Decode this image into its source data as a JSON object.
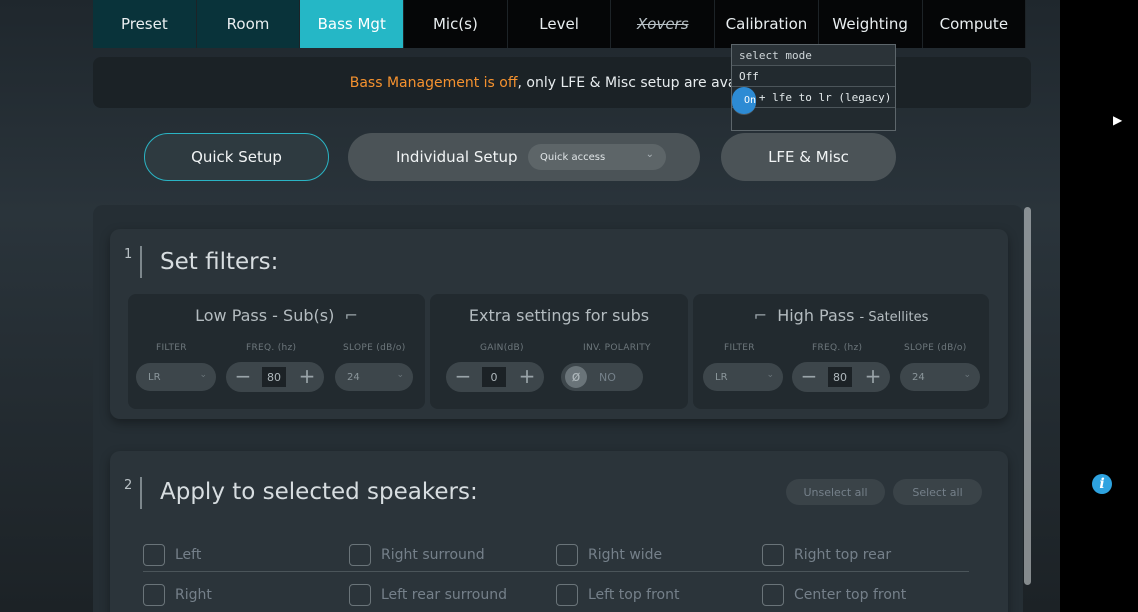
{
  "tabs": [
    "Preset",
    "Room",
    "Bass Mgt",
    "Mic(s)",
    "Level",
    "Xovers",
    "Calibration",
    "Weighting",
    "Compute"
  ],
  "notice": {
    "highlight": "Bass Management is off",
    "rest": ", only LFE & Misc setup are available"
  },
  "mode_buttons": {
    "quick": "Quick Setup",
    "individual": "Individual Setup",
    "quick_access": "Quick access",
    "lfe": "LFE & Misc"
  },
  "dropdown": {
    "header": "select mode",
    "options": [
      "Off",
      "On",
      "On + lfe to lr (legacy)"
    ],
    "selected": "On"
  },
  "step1": {
    "number": "1",
    "title": "Set filters:",
    "low_pass": {
      "title": "Low Pass - Sub(s)",
      "filter_label": "FILTER",
      "filter_value": "LR",
      "freq_label": "FREQ. (hz)",
      "freq_value": "80",
      "slope_label": "SLOPE (dB/o)",
      "slope_value": "24"
    },
    "extra": {
      "title": "Extra settings for subs",
      "gain_label": "GAIN(dB)",
      "gain_value": "0",
      "polarity_label": "INV. POLARITY",
      "polarity_value": "NO"
    },
    "high_pass": {
      "title": "High Pass",
      "title_suffix": "- Satellites",
      "filter_label": "FILTER",
      "filter_value": "LR",
      "freq_label": "FREQ. (hz)",
      "freq_value": "80",
      "slope_label": "SLOPE (dB/o)",
      "slope_value": "24"
    }
  },
  "step2": {
    "number": "2",
    "title": "Apply to selected speakers:",
    "unselect_all": "Unselect all",
    "select_all": "Select all",
    "speakers": [
      "Left",
      "Right surround",
      "Right wide",
      "Right top rear",
      "Right",
      "Left rear surround",
      "Left top front",
      "Center top front"
    ]
  },
  "icons": {
    "info": "info-icon",
    "cursor": "pointer-cursor"
  }
}
